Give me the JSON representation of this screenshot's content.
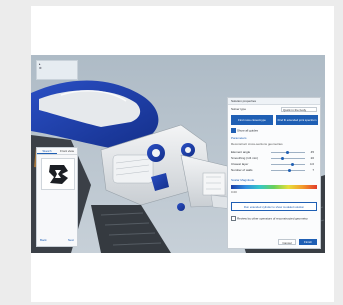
{
  "viewport": {
    "toolbar": {
      "rows": [
        "",
        "",
        ""
      ]
    }
  },
  "left_panel": {
    "tabs": [
      "Sketch",
      "Front view"
    ],
    "preview_label": "",
    "hint": "",
    "nav_left": "Back",
    "nav_right": "Next"
  },
  "right_panel": {
    "header": "Solution properties",
    "solver_label": "Solver type",
    "solver_value": "Quick in the body",
    "buttons": {
      "primary_1": "Find more closed-type",
      "primary_2": "Find fit extended joint spectrum"
    },
    "check_1": "Show all guides",
    "section_label": "Parameters",
    "sub_label": "Reconstruct cross-sections geometries",
    "sliders": [
      {
        "label": "Element angle",
        "value": "45"
      },
      {
        "label": "Smoothing (1/4 min)",
        "value": "20"
      },
      {
        "label": "Closest layer",
        "value": "4.0"
      },
      {
        "label": "Number of walls",
        "value": "7"
      }
    ],
    "gradient_label": "Scalar Magnitude",
    "gradient_scale": "0.00",
    "action_button": "Run extended cylinder to show modeled solution",
    "check_2": "Review by other operators of reconstructed geometry",
    "footer": {
      "cancel": "Cancel",
      "ok": "Finish"
    }
  },
  "colors": {
    "accent": "#1f5fb4",
    "background": "#b9c5cf",
    "model_blue": "#1b3aa3"
  },
  "icons": [
    "cursor-icon",
    "gear-icon",
    "shape-preview-icon"
  ]
}
